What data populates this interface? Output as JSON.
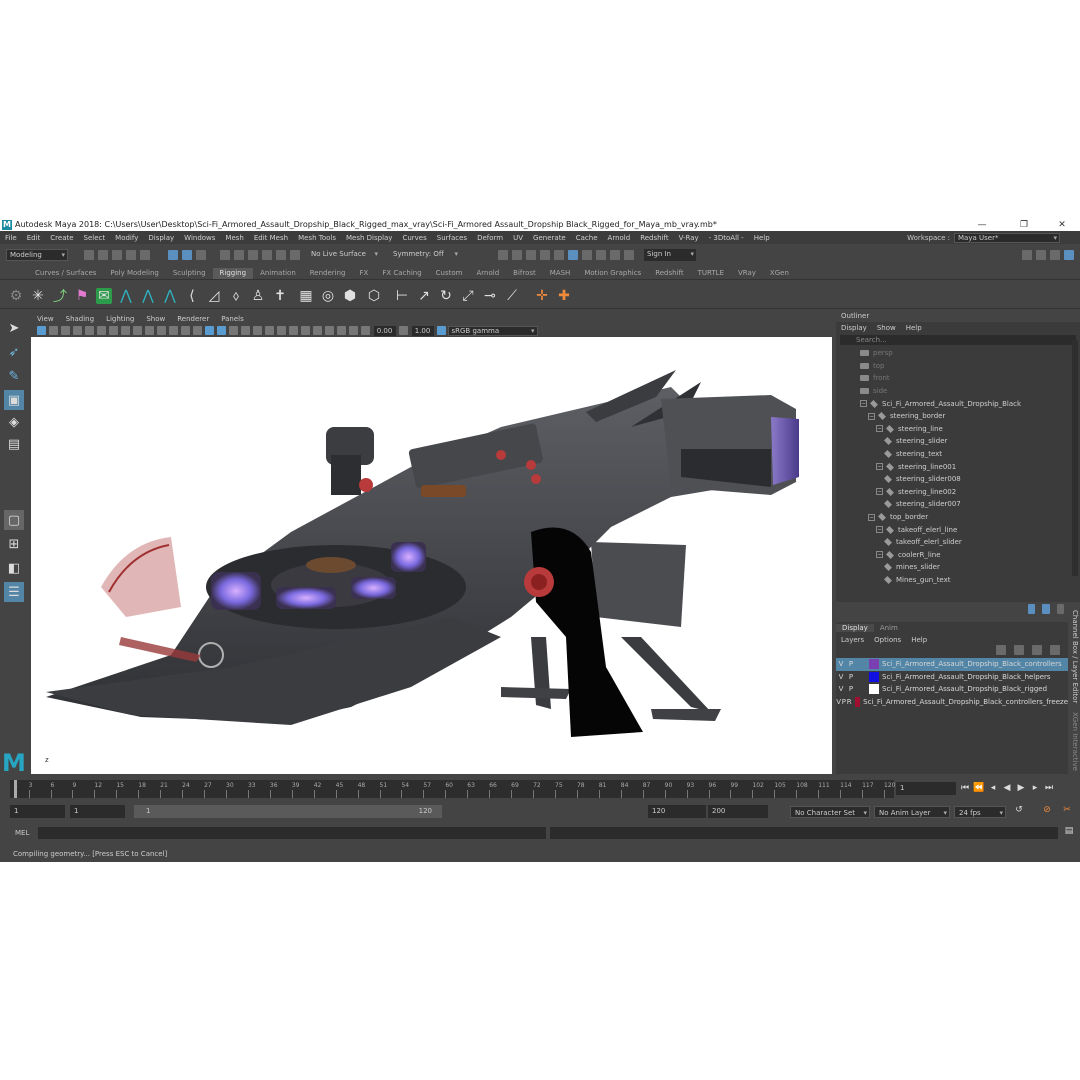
{
  "window": {
    "title": "Autodesk Maya 2018: C:\\Users\\User\\Desktop\\Sci-Fi_Armored_Assault_Dropship_Black_Rigged_max_vray\\Sci-Fi_Armored Assault_Dropship Black_Rigged_for_Maya_mb_vray.mb*",
    "logo_letter": "M"
  },
  "menu": [
    "File",
    "Edit",
    "Create",
    "Select",
    "Modify",
    "Display",
    "Windows",
    "Mesh",
    "Edit Mesh",
    "Mesh Tools",
    "Mesh Display",
    "Curves",
    "Surfaces",
    "Deform",
    "UV",
    "Generate",
    "Cache",
    "Arnold",
    "Redshift",
    "V-Ray",
    "- 3DtoAll -",
    "Help"
  ],
  "workspace": {
    "label": "Workspace :",
    "value": "Maya User*"
  },
  "status_line": {
    "mode": "Modeling",
    "live_surface": "No Live Surface",
    "symmetry": "Symmetry: Off",
    "sign_in": "Sign In"
  },
  "shelf_tabs": [
    "Curves / Surfaces",
    "Poly Modeling",
    "Sculpting",
    "Rigging",
    "Animation",
    "Rendering",
    "FX",
    "FX Caching",
    "Custom",
    "Arnold",
    "Bifrost",
    "MASH",
    "Motion Graphics",
    "Redshift",
    "TURTLE",
    "VRay",
    "XGen"
  ],
  "active_shelf_tab": "Rigging",
  "viewport_menu": [
    "View",
    "Shading",
    "Lighting",
    "Show",
    "Renderer",
    "Panels"
  ],
  "viewport_toolbar": {
    "exposure": "0.00",
    "gamma": "1.00",
    "color_space": "sRGB gamma"
  },
  "viewport": {
    "axis_label": "z"
  },
  "outliner": {
    "title": "Outliner",
    "menu": [
      "Display",
      "Show",
      "Help"
    ],
    "search_placeholder": "Search...",
    "items": [
      {
        "label": "persp",
        "type": "camera",
        "depth": 0
      },
      {
        "label": "top",
        "type": "camera",
        "depth": 0
      },
      {
        "label": "front",
        "type": "camera",
        "depth": 0
      },
      {
        "label": "side",
        "type": "camera",
        "depth": 0
      },
      {
        "label": "Sci_Fi_Armored_Assault_Dropship_Black",
        "type": "group",
        "depth": 0
      },
      {
        "label": "steering_border",
        "type": "group",
        "depth": 1
      },
      {
        "label": "steering_line",
        "type": "group",
        "depth": 2
      },
      {
        "label": "steering_slider",
        "type": "node",
        "depth": 3
      },
      {
        "label": "steering_text",
        "type": "node",
        "depth": 3
      },
      {
        "label": "steering_line001",
        "type": "group",
        "depth": 2
      },
      {
        "label": "steering_slider008",
        "type": "node",
        "depth": 3
      },
      {
        "label": "steering_line002",
        "type": "group",
        "depth": 2
      },
      {
        "label": "steering_slider007",
        "type": "node",
        "depth": 3
      },
      {
        "label": "top_border",
        "type": "group",
        "depth": 1
      },
      {
        "label": "takeoff_elerl_line",
        "type": "group",
        "depth": 2
      },
      {
        "label": "takeoff_elerl_slider",
        "type": "node",
        "depth": 3
      },
      {
        "label": "coolerR_line",
        "type": "group",
        "depth": 2
      },
      {
        "label": "mines_slider",
        "type": "node",
        "depth": 3
      },
      {
        "label": "Mines_gun_text",
        "type": "node",
        "depth": 3
      }
    ]
  },
  "layer_editor": {
    "tabs": [
      "Display",
      "Anim"
    ],
    "menu": [
      "Layers",
      "Options",
      "Help"
    ],
    "side_tabs": [
      "Channel Box / Layer Editor",
      "XGen Interactive"
    ],
    "layers": [
      {
        "v": "V",
        "p": "P",
        "r": "",
        "color": "#7a3fb0",
        "name": "Sci_Fi_Armored_Assault_Dropship_Black_controllers",
        "selected": true
      },
      {
        "v": "V",
        "p": "P",
        "r": "",
        "color": "#1010e0",
        "name": "Sci_Fi_Armored_Assault_Dropship_Black_helpers",
        "selected": false
      },
      {
        "v": "V",
        "p": "P",
        "r": "",
        "color": "#ffffff",
        "name": "Sci_Fi_Armored_Assault_Dropship_Black_rigged",
        "selected": false
      },
      {
        "v": "V",
        "p": "P",
        "r": "R",
        "color": "#a01030",
        "name": "Sci_Fi_Armored_Assault_Dropship_Black_controllers_freeze",
        "selected": false
      }
    ]
  },
  "time_slider": {
    "ticks": [
      "1",
      "3",
      "6",
      "9",
      "12",
      "15",
      "18",
      "21",
      "24",
      "27",
      "30",
      "33",
      "36",
      "39",
      "42",
      "45",
      "48",
      "51",
      "54",
      "57",
      "60",
      "63",
      "66",
      "69",
      "72",
      "75",
      "78",
      "81",
      "84",
      "87",
      "90",
      "93",
      "96",
      "99",
      "102",
      "105",
      "108",
      "111",
      "114",
      "117",
      "120"
    ],
    "current_frame": "1"
  },
  "range_slider": {
    "start": "1",
    "playback_start": "1",
    "range_inner_start": "1",
    "range_inner_end": "120",
    "playback_end": "120",
    "end": "200",
    "character_set": "No Character Set",
    "anim_layer": "No Anim Layer",
    "fps": "24 fps"
  },
  "command_line": {
    "label": "MEL"
  },
  "help_line": "Compiling geometry... [Press ESC to Cancel]",
  "colors": {
    "selection": "#5285a6",
    "maya_teal": "#27a6c4"
  }
}
